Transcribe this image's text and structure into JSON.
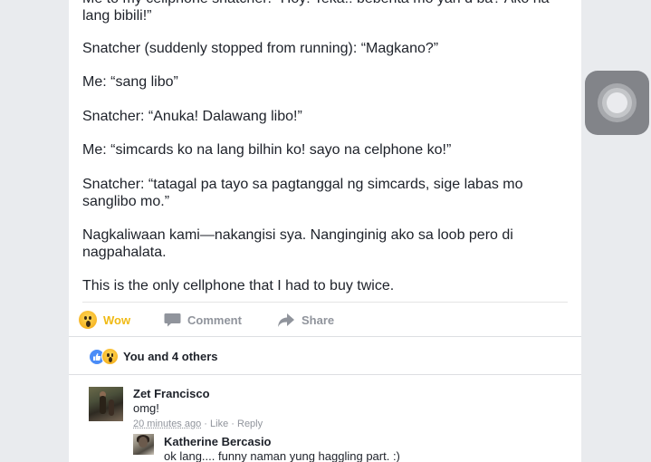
{
  "post": {
    "paragraphs": [
      "Me to my cellphone snatcher: “Hoy! Teka!! bebenta mo yan d ba? Ako na lang bibili!”",
      "Snatcher (suddenly stopped from running): “Magkano?”",
      "Me: “sang libo”",
      "Snatcher: “Anuka! Dalawang libo!”",
      "Me: “simcards ko na lang bilhin ko! sayo na celphone ko!”",
      "Snatcher: “tatagal pa tayo sa pagtanggal ng simcards, sige labas mo sanglibo mo.”",
      "Nagkaliwaan kami—nakangisi sya. Nanginginig ako sa loob pero di nagpahalata.",
      "This is the only cellphone that I had to buy twice."
    ]
  },
  "actions": {
    "wow": "Wow",
    "comment": "Comment",
    "share": "Share"
  },
  "reactions": {
    "summary": "You and 4 others",
    "icons": [
      "like-icon",
      "wow-icon"
    ]
  },
  "comments": [
    {
      "name": "Zet Francisco",
      "text": "omg!",
      "time": "20 minutes ago",
      "like": "Like",
      "reply": "Reply"
    }
  ],
  "replies": [
    {
      "name": "Katherine Bercasio",
      "text": "ok lang.... funny naman yung haggling part. :)"
    }
  ],
  "colors": {
    "wow_active": "#f0ba15",
    "muted": "#90949c",
    "text": "#1d2129",
    "like_blue": "#4a8cf7",
    "background": "#e9ebee"
  },
  "assistive_touch": {
    "icon": "assistive-touch-icon"
  }
}
